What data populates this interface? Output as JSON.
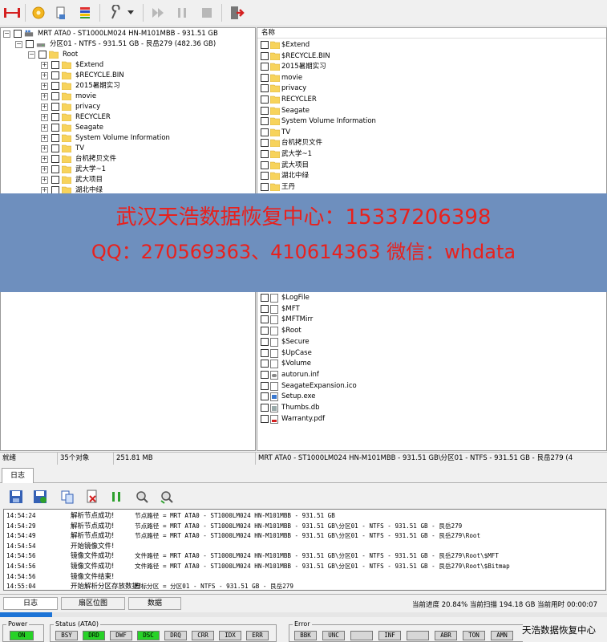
{
  "toolbar": {
    "icons": [
      "disk-connect-icon",
      "gear-icon",
      "scan-icon",
      "color-bars-icon",
      "filter-icon",
      "dropdown-icon",
      "play-icon",
      "pause-icon",
      "stop-icon",
      "exit-icon"
    ]
  },
  "tree": {
    "device": "MRT ATA0 - ST1000LM024 HN-M101MBB - 931.51 GB",
    "partition": "分区01 - NTFS - 931.51 GB - 艮岳279 (482.36 GB)",
    "root": "Root",
    "folders": [
      "$Extend",
      "$RECYCLE.BIN",
      "2015暑期实习",
      "movie",
      "privacy",
      "RECYCLER",
      "Seagate",
      "System Volume Information",
      "TV",
      "台机拷贝文件",
      "武大学~1",
      "武大项目",
      "湖北中绿"
    ]
  },
  "list": {
    "header": "名称",
    "top_items": [
      "$Extend",
      "$RECYCLE.BIN",
      "2015暑期实习",
      "movie",
      "privacy",
      "RECYCLER",
      "Seagate",
      "System Volume Information",
      "TV",
      "台机拷贝文件",
      "武大学~1",
      "武大项目",
      "湖北中绿",
      "王丹"
    ],
    "bottom_items": [
      "$LogFile",
      "$MFT",
      "$MFTMirr",
      "$Root",
      "$Secure",
      "$UpCase",
      "$Volume",
      "autorun.inf",
      "SeagateExpansion.ico",
      "Setup.exe",
      "Thumbs.db",
      "Warranty.pdf"
    ],
    "bottom_types": [
      "doc",
      "doc",
      "doc",
      "doc",
      "doc",
      "doc",
      "doc",
      "inf",
      "doc",
      "exe",
      "db",
      "pdf"
    ]
  },
  "watermark": {
    "line1": "武汉天浩数据恢复中心：15337206398",
    "line2": "QQ：270569363、410614363   微信：whdata"
  },
  "statusbar": {
    "state": "就绪",
    "count": "35个对象",
    "size": "251.81 MB",
    "path": "MRT ATA0 - ST1000LM024 HN-M101MBB - 931.51 GB\\分区01 - NTFS - 931.51 GB - 艮岳279 (4"
  },
  "log": {
    "tab_label": "日志",
    "rows": [
      {
        "time": "14:54:24",
        "msg": "解析节点成功!",
        "detail": "节点路径 = MRT ATA0 - ST1000LM024 HN-M101MBB - 931.51 GB"
      },
      {
        "time": "14:54:29",
        "msg": "解析节点成功!",
        "detail": "节点路径 = MRT ATA0 - ST1000LM024 HN-M101MBB - 931.51 GB\\分区01 - NTFS - 931.51 GB - 艮岳279"
      },
      {
        "time": "14:54:49",
        "msg": "解析节点成功!",
        "detail": "节点路径 = MRT ATA0 - ST1000LM024 HN-M101MBB - 931.51 GB\\分区01 - NTFS - 931.51 GB - 艮岳279\\Root"
      },
      {
        "time": "14:54:54",
        "msg": "开始镜像文件!",
        "detail": ""
      },
      {
        "time": "14:54:56",
        "msg": "镜像文件成功!",
        "detail": "  文件路径 = MRT ATA0 - ST1000LM024 HN-M101MBB - 931.51 GB\\分区01 - NTFS - 931.51 GB - 艮岳279\\Root\\$MFT"
      },
      {
        "time": "14:54:56",
        "msg": "镜像文件成功!",
        "detail": "  文件路径 = MRT ATA0 - ST1000LM024 HN-M101MBB - 931.51 GB\\分区01 - NTFS - 931.51 GB - 艮岳279\\Root\\$Bitmap"
      },
      {
        "time": "14:54:56",
        "msg": "镜像文件结束!",
        "detail": ""
      },
      {
        "time": "14:55:04",
        "msg": "开始解析分区存放数据!",
        "detail": "目标分区 = 分区01 - NTFS - 931.51 GB - 艮岳279"
      }
    ]
  },
  "bottom_tabs": {
    "log": "日志",
    "partition_map": "扇区位图",
    "data": "数据"
  },
  "progress": {
    "text": "当前进度 20.84% 当前扫描 194.18 GB 当前用时 00:00:07",
    "fraction": 0.2084
  },
  "indicators": {
    "power_label": "Power",
    "power": "ON",
    "status_label": "Status (ATA0)",
    "status": [
      {
        "name": "BSY",
        "on": false
      },
      {
        "name": "DRD",
        "on": true
      },
      {
        "name": "DWF",
        "on": false
      },
      {
        "name": "DSC",
        "on": true
      },
      {
        "name": "DRQ",
        "on": false
      },
      {
        "name": "CRR",
        "on": false
      },
      {
        "name": "IDX",
        "on": false
      },
      {
        "name": "ERR",
        "on": false
      }
    ],
    "error_label": "Error",
    "errors": [
      "BBK",
      "UNC",
      "",
      "INF",
      "",
      "ABR",
      "TON",
      "AMN"
    ]
  },
  "corner_text": "天浩数据恢复中心",
  "colors": {
    "band": "#6e8fbe",
    "watermark_text": "#e8211d",
    "led_on": "#27d227",
    "progress": "#1c73d6"
  }
}
